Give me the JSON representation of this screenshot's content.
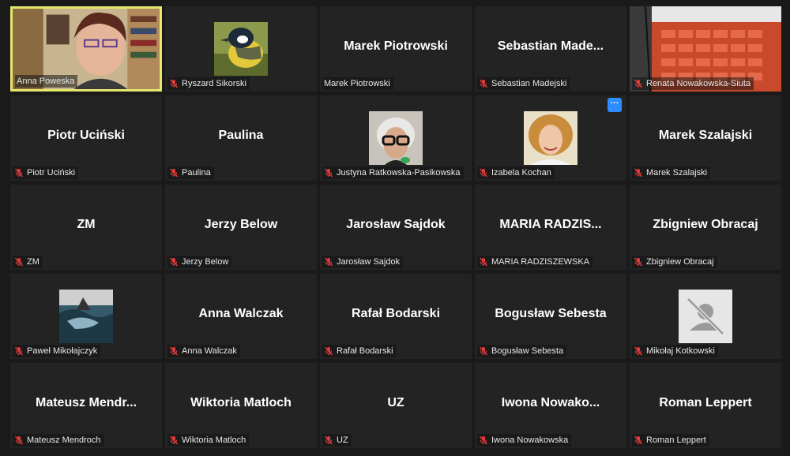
{
  "participants": [
    {
      "name": "Anna Poweska",
      "display": "",
      "type": "video",
      "muted": false
    },
    {
      "name": "Ryszard Sikorski",
      "display": "",
      "type": "avatar",
      "avatar": "bird",
      "muted": true
    },
    {
      "name": "Marek Piotrowski",
      "display": "Marek Piotrowski",
      "type": "name",
      "muted": false
    },
    {
      "name": "Sebastian Madejski",
      "display": "Sebastian  Made...",
      "type": "name",
      "muted": true
    },
    {
      "name": "Renata Nowakowska-Siuta",
      "display": "",
      "type": "video",
      "muted": true
    },
    {
      "name": "Piotr Uciński",
      "display": "Piotr Uciński",
      "type": "name",
      "muted": true
    },
    {
      "name": "Paulina",
      "display": "Paulina",
      "type": "name",
      "muted": true
    },
    {
      "name": "Justyna Ratkowska-Pasikowska",
      "display": "",
      "type": "avatar",
      "avatar": "woman-glasses",
      "muted": true
    },
    {
      "name": "Izabela Kochan",
      "display": "",
      "type": "avatar",
      "avatar": "woman-curly",
      "muted": true,
      "more": "···"
    },
    {
      "name": "Marek Szalajski",
      "display": "Marek Szalajski",
      "type": "name",
      "muted": true
    },
    {
      "name": "ZM",
      "display": "ZM",
      "type": "name",
      "muted": true
    },
    {
      "name": "Jerzy Below",
      "display": "Jerzy Below",
      "type": "name",
      "muted": true
    },
    {
      "name": "Jarosław Sajdok",
      "display": "Jarosław Sajdok",
      "type": "name",
      "muted": true
    },
    {
      "name": "MARIA RADZISZEWSKA",
      "display": "MARIA  RADZIS...",
      "type": "name",
      "muted": true
    },
    {
      "name": "Zbigniew Obracaj",
      "display": "Zbigniew Obracaj",
      "type": "name",
      "muted": true
    },
    {
      "name": "Paweł Mikołajczyk",
      "display": "",
      "type": "avatar",
      "avatar": "water",
      "muted": true
    },
    {
      "name": "Anna Walczak",
      "display": "Anna Walczak",
      "type": "name",
      "muted": true
    },
    {
      "name": "Rafał Bodarski",
      "display": "Rafał Bodarski",
      "type": "name",
      "muted": true
    },
    {
      "name": "Bogusław Sebesta",
      "display": "Bogusław Sebesta",
      "type": "name",
      "muted": true
    },
    {
      "name": "Mikołaj Kotkowski",
      "display": "",
      "type": "avatar",
      "avatar": "placeholder",
      "muted": true
    },
    {
      "name": "Mateusz Mendroch",
      "display": "Mateusz  Mendr...",
      "type": "name",
      "muted": true
    },
    {
      "name": "Wiktoria Matloch",
      "display": "Wiktoria Matloch",
      "type": "name",
      "muted": true
    },
    {
      "name": "UZ",
      "display": "UZ",
      "type": "name",
      "muted": true
    },
    {
      "name": "Iwona Nowakowska",
      "display": "Iwona  Nowako...",
      "type": "name",
      "muted": true
    },
    {
      "name": "Roman Leppert",
      "display": "Roman Leppert",
      "type": "name",
      "muted": true
    }
  ],
  "colors": {
    "active_speaker_border": "#e5e86b",
    "muted_icon": "#e03a3a",
    "more_button": "#2d8cff"
  }
}
